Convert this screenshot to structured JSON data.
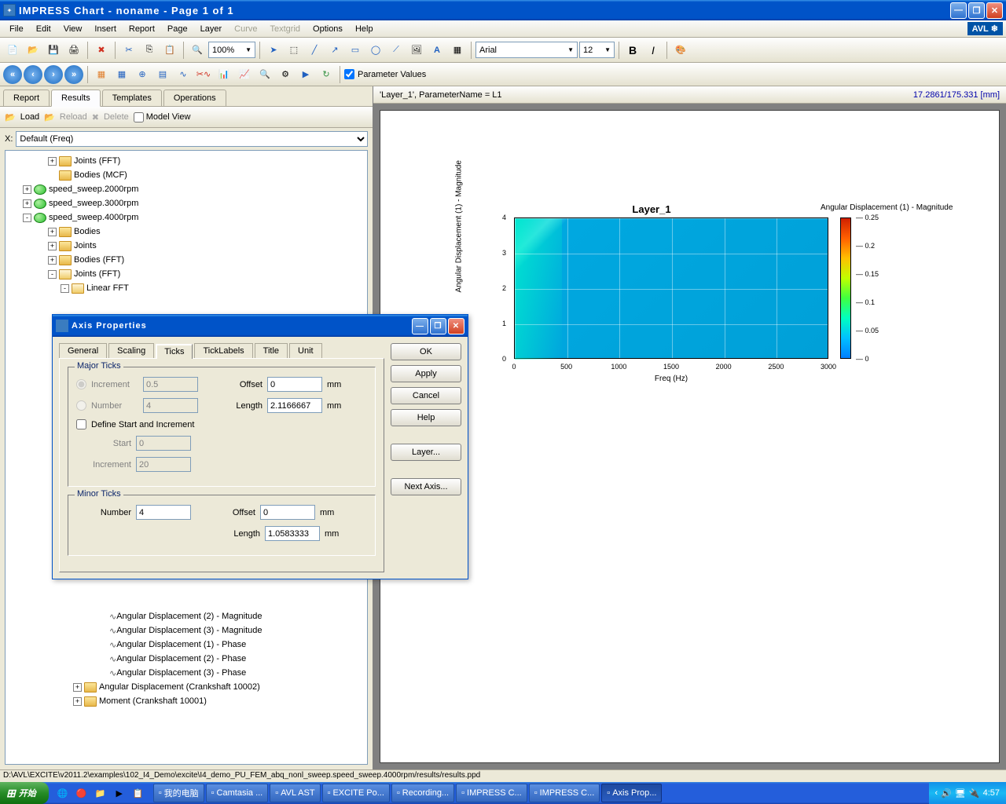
{
  "window": {
    "title": "IMPRESS Chart - noname - Page 1 of 1",
    "app_icon": "AVL"
  },
  "menu": [
    "File",
    "Edit",
    "View",
    "Insert",
    "Report",
    "Page",
    "Layer",
    "Curve",
    "Textgrid",
    "Options",
    "Help"
  ],
  "menu_disabled": [
    "Curve",
    "Textgrid"
  ],
  "logo": "AVL",
  "toolbar": {
    "zoom": "100%",
    "font_name": "Arial",
    "font_size": "12"
  },
  "navbar": {
    "checkbox": "Parameter Values"
  },
  "sidebar": {
    "tabs": [
      "Report",
      "Results",
      "Templates",
      "Operations"
    ],
    "active_tab": "Results",
    "tools": {
      "load": "Load",
      "reload": "Reload",
      "delete": "Delete",
      "model_view": "Model View"
    },
    "x_label": "X:",
    "x_value": "Default (Freq)",
    "tree": [
      {
        "indent": 3,
        "exp": "+",
        "ico": "folder",
        "label": "Joints (FFT)"
      },
      {
        "indent": 3,
        "exp": "",
        "ico": "folder",
        "label": "Bodies (MCF)"
      },
      {
        "indent": 1,
        "exp": "+",
        "ico": "green",
        "label": "speed_sweep.2000rpm"
      },
      {
        "indent": 1,
        "exp": "+",
        "ico": "green",
        "label": "speed_sweep.3000rpm"
      },
      {
        "indent": 1,
        "exp": "-",
        "ico": "green",
        "label": "speed_sweep.4000rpm"
      },
      {
        "indent": 3,
        "exp": "+",
        "ico": "folder",
        "label": "Bodies"
      },
      {
        "indent": 3,
        "exp": "+",
        "ico": "folder",
        "label": "Joints"
      },
      {
        "indent": 3,
        "exp": "+",
        "ico": "folder",
        "label": "Bodies (FFT)"
      },
      {
        "indent": 3,
        "exp": "-",
        "ico": "folder-open",
        "label": "Joints (FFT)"
      },
      {
        "indent": 4,
        "exp": "-",
        "ico": "folder-open",
        "label": "Linear FFT"
      }
    ],
    "tree_bottom": [
      {
        "indent": 7,
        "ico": "wave",
        "label": "Angular Displacement (2) - Magnitude"
      },
      {
        "indent": 7,
        "ico": "wave",
        "label": "Angular Displacement (3) - Magnitude"
      },
      {
        "indent": 7,
        "ico": "wave",
        "label": "Angular Displacement (1) - Phase"
      },
      {
        "indent": 7,
        "ico": "wave",
        "label": "Angular Displacement (2) - Phase"
      },
      {
        "indent": 7,
        "ico": "wave",
        "label": "Angular Displacement (3) - Phase"
      },
      {
        "indent": 5,
        "exp": "+",
        "ico": "folder",
        "label": "Angular Displacement (Crankshaft 10002)"
      },
      {
        "indent": 5,
        "exp": "+",
        "ico": "folder",
        "label": "Moment (Crankshaft 10001)"
      }
    ]
  },
  "info_row": {
    "left": "'Layer_1', ParameterName = L1",
    "right": "17.2861/175.331 [mm]"
  },
  "chart_data": {
    "type": "heatmap",
    "title": "Layer_1",
    "xlabel": "Freq (Hz)",
    "ylabel": "Angular Displacement (1) - Magnitude",
    "colorbar_label": "Angular Displacement (1) - Magnitude",
    "x_ticks": [
      0,
      500,
      1000,
      1500,
      2000,
      2500,
      3000
    ],
    "y_ticks": [
      0,
      1,
      2,
      3,
      4
    ],
    "xlim": [
      0,
      3000
    ],
    "ylim": [
      0,
      4
    ],
    "colorbar_ticks": [
      0,
      0.05,
      0.1,
      0.15,
      0.2,
      0.25
    ],
    "colorbar_range": [
      0,
      0.25
    ]
  },
  "dialog": {
    "title": "Axis Properties",
    "tabs": [
      "General",
      "Scaling",
      "Ticks",
      "TickLabels",
      "Title",
      "Unit"
    ],
    "active_tab": "Ticks",
    "major": {
      "legend": "Major Ticks",
      "increment_label": "Increment",
      "increment_value": "0.5",
      "number_label": "Number",
      "number_value": "4",
      "offset_label": "Offset",
      "offset_value": "0",
      "length_label": "Length",
      "length_value": "2.1166667",
      "unit": "mm",
      "define_label": "Define Start and Increment",
      "start_label": "Start",
      "start_value": "0",
      "incr2_label": "Increment",
      "incr2_value": "20"
    },
    "minor": {
      "legend": "Minor Ticks",
      "number_label": "Number",
      "number_value": "4",
      "offset_label": "Offset",
      "offset_value": "0",
      "length_label": "Length",
      "length_value": "1.0583333",
      "unit": "mm"
    },
    "buttons": [
      "OK",
      "Apply",
      "Cancel",
      "Help",
      "Layer...",
      "Next Axis..."
    ]
  },
  "statusbar": "D:\\AVL\\EXCITE\\v2011.2\\examples\\102_I4_Demo\\excite\\I4_demo_PU_FEM_abq_nonl_sweep.speed_sweep.4000rpm/results/results.ppd",
  "taskbar": {
    "start": "开始",
    "items": [
      "我的电脑",
      "Camtasia ...",
      "AVL AST",
      "EXCITE Po...",
      "Recording...",
      "IMPRESS C...",
      "IMPRESS C...",
      "Axis Prop..."
    ],
    "active_item": 7,
    "clock": "4:57"
  }
}
